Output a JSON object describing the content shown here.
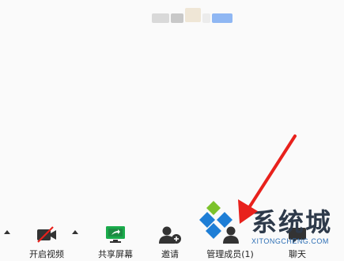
{
  "toolbar": {
    "start_video": "开启视频",
    "share_screen": "共享屏幕",
    "invite": "邀请",
    "manage_members": "管理成员(1)",
    "chat": "聊天"
  },
  "watermark": {
    "brand": "系统城",
    "url": "XITONGCHENG.COM"
  },
  "colors": {
    "share_green": "#1aab4b",
    "arrow_red": "#e8211c",
    "logo_blue": "#1e7ed6",
    "logo_green": "#7cc22b"
  }
}
